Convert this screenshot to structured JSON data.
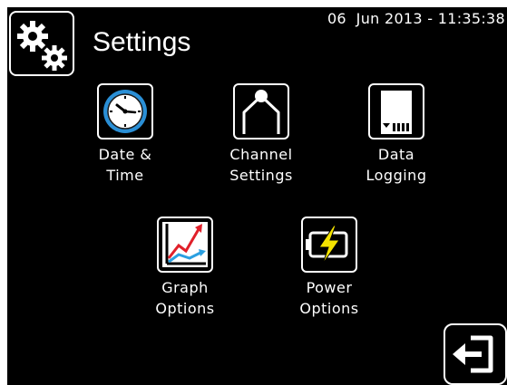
{
  "header": {
    "title": "Settings",
    "datetime": "06  Jun 2013 - 11:35:38",
    "icon": "gears-icon"
  },
  "menu": {
    "items": [
      {
        "id": "date-time",
        "icon": "clock-icon",
        "line1": "Date &",
        "line2": "Time"
      },
      {
        "id": "channel-settings",
        "icon": "probe-icon",
        "line1": "Channel",
        "line2": "Settings"
      },
      {
        "id": "data-logging",
        "icon": "sd-card-icon",
        "line1": "Data",
        "line2": "Logging"
      },
      {
        "id": "graph-options",
        "icon": "graph-icon",
        "line1": "Graph",
        "line2": "Options"
      },
      {
        "id": "power-options",
        "icon": "battery-icon",
        "line1": "Power",
        "line2": "Options"
      }
    ]
  },
  "footer": {
    "exit_icon": "exit-icon"
  },
  "colors": {
    "background": "#000000",
    "foreground": "#ffffff",
    "clock_blue": "#2a8fd6",
    "graph_red": "#e0202a",
    "graph_blue": "#2a9fe0",
    "bolt_yellow": "#f5e400"
  }
}
